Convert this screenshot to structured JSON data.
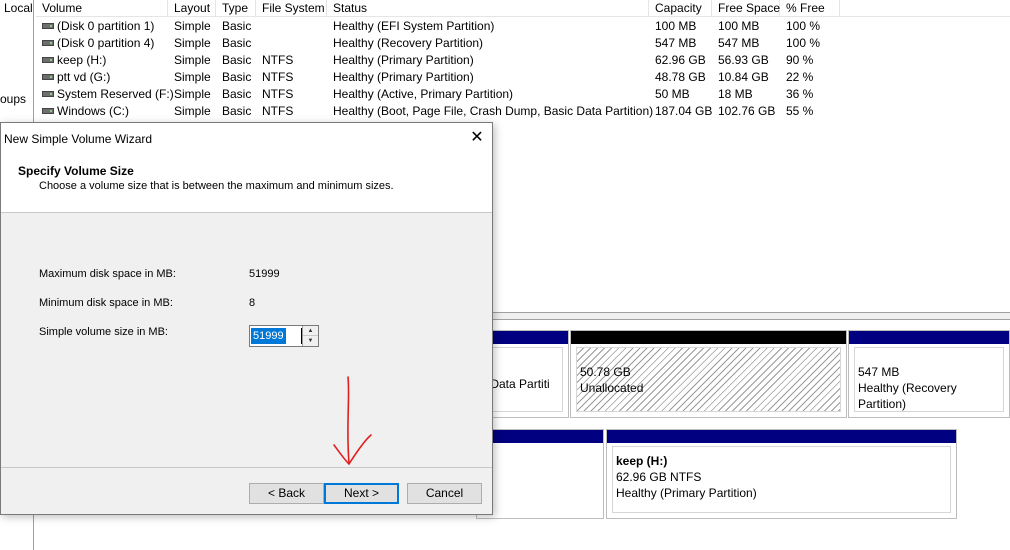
{
  "left_pane": {
    "line1": "Local",
    "line2": "roups"
  },
  "columns": [
    "Volume",
    "Layout",
    "Type",
    "File System",
    "Status",
    "Capacity",
    "Free Space",
    "% Free"
  ],
  "volumes": [
    {
      "name": "(Disk 0 partition 1)",
      "layout": "Simple",
      "type": "Basic",
      "fs": "",
      "status": "Healthy (EFI System Partition)",
      "capacity": "100 MB",
      "free": "100 MB",
      "pct": "100 %"
    },
    {
      "name": "(Disk 0 partition 4)",
      "layout": "Simple",
      "type": "Basic",
      "fs": "",
      "status": "Healthy (Recovery Partition)",
      "capacity": "547 MB",
      "free": "547 MB",
      "pct": "100 %"
    },
    {
      "name": "keep (H:)",
      "layout": "Simple",
      "type": "Basic",
      "fs": "NTFS",
      "status": "Healthy (Primary Partition)",
      "capacity": "62.96 GB",
      "free": "56.93 GB",
      "pct": "90 %"
    },
    {
      "name": "ptt vd (G:)",
      "layout": "Simple",
      "type": "Basic",
      "fs": "NTFS",
      "status": "Healthy (Primary Partition)",
      "capacity": "48.78 GB",
      "free": "10.84 GB",
      "pct": "22 %"
    },
    {
      "name": "System Reserved (F:)",
      "layout": "Simple",
      "type": "Basic",
      "fs": "NTFS",
      "status": "Healthy (Active, Primary Partition)",
      "capacity": "50 MB",
      "free": "18 MB",
      "pct": "36 %"
    },
    {
      "name": "Windows (C:)",
      "layout": "Simple",
      "type": "Basic",
      "fs": "NTFS",
      "status": "Healthy (Boot, Page File, Crash Dump, Basic Data Partition)",
      "capacity": "187.04 GB",
      "free": "102.76 GB",
      "pct": "55 %"
    }
  ],
  "disk_blocks": {
    "partial_label": "c Data Partiti",
    "unallocated": {
      "size": "50.78 GB",
      "label": "Unallocated"
    },
    "recovery": {
      "size": "547 MB",
      "status": "Healthy (Recovery Partition)"
    },
    "keep": {
      "name": "keep  (H:)",
      "detail": "62.96 GB NTFS",
      "status": "Healthy (Primary Partition)"
    }
  },
  "dialog": {
    "title": "New Simple Volume Wizard",
    "close_glyph": "✕",
    "heading": "Specify Volume Size",
    "subheading": "Choose a volume size that is between the maximum and minimum sizes.",
    "max_label": "Maximum disk space in MB:",
    "max_value": "51999",
    "min_label": "Minimum disk space in MB:",
    "min_value": "8",
    "size_label": "Simple volume size in MB:",
    "size_value": "51999",
    "spin_up": "▲",
    "spin_down": "▼",
    "back_label": "< Back",
    "next_label": "Next >",
    "cancel_label": "Cancel"
  },
  "colors": {
    "partition_bar": "#000080",
    "unallocated_bar": "#000000",
    "selection": "#0078d7",
    "annotation": "#e02020"
  }
}
